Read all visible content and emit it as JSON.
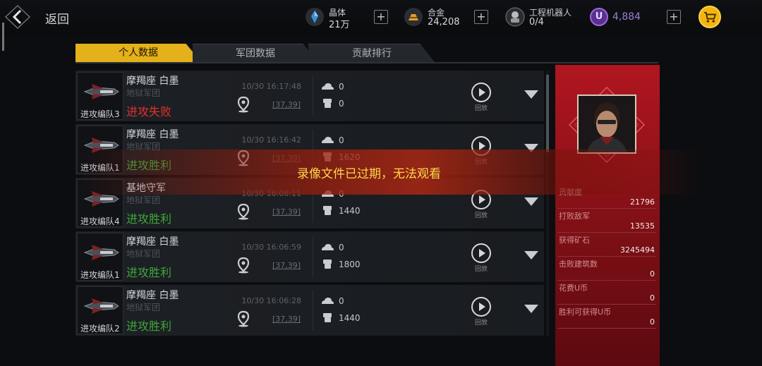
{
  "header": {
    "back_label": "返回",
    "resources": [
      {
        "name": "晶体",
        "value": "21万",
        "icon": "crystal-icon",
        "color": "#3a8fd6"
      },
      {
        "name": "合金",
        "value": "24,208",
        "icon": "alloy-icon",
        "color": "#e0a028"
      },
      {
        "name": "工程机器人",
        "value": "0/4",
        "icon": "robot-icon",
        "color": "#bbbbbb"
      }
    ],
    "u_coin": {
      "symbol": "U",
      "value": "4,884"
    },
    "plus": "+"
  },
  "tabs": [
    {
      "label": "个人数据",
      "active": true
    },
    {
      "label": "军团数据",
      "active": false
    },
    {
      "label": "贡献排行",
      "active": false
    }
  ],
  "records": [
    {
      "team": "进攻编队3",
      "opponent": "摩羯座 白墨",
      "legion": "地狱军团",
      "result": "进攻失败",
      "result_type": "fail",
      "time": "10/30 16:17:48",
      "coord": "[37,39]",
      "loot": "0",
      "power": "0",
      "replay": "回放"
    },
    {
      "team": "进攻编队1",
      "opponent": "摩羯座 白墨",
      "legion": "地狱军团",
      "result": "进攻胜利",
      "result_type": "win",
      "time": "10/30 16:16:42",
      "coord": "[37,39]",
      "loot": "0",
      "power": "1620",
      "replay": "回放"
    },
    {
      "team": "进攻编队4",
      "opponent": "基地守军",
      "legion": "地狱军团",
      "result": "进攻胜利",
      "result_type": "win",
      "time": "10/30 16:08:11",
      "coord": "[37,39]",
      "loot": "0",
      "power": "1440",
      "replay": "回放"
    },
    {
      "team": "进攻编队1",
      "opponent": "摩羯座 白墨",
      "legion": "地狱军团",
      "result": "进攻胜利",
      "result_type": "win",
      "time": "10/30 16:06:59",
      "coord": "[37,39]",
      "loot": "0",
      "power": "1800",
      "replay": "回放"
    },
    {
      "team": "进攻编队2",
      "opponent": "摩羯座 白墨",
      "legion": "地狱军团",
      "result": "进攻胜利",
      "result_type": "win",
      "time": "10/30 16:06:28",
      "coord": "[37,39]",
      "loot": "0",
      "power": "1440",
      "replay": "回放"
    }
  ],
  "stats": [
    {
      "label": "贡献度",
      "value": "21796"
    },
    {
      "label": "打败敌军",
      "value": "13535"
    },
    {
      "label": "获得矿石",
      "value": "3245494"
    },
    {
      "label": "击败建筑数",
      "value": "0"
    },
    {
      "label": "花费U币",
      "value": "0"
    },
    {
      "label": "胜利可获得U币",
      "value": "0"
    }
  ],
  "toast": "录像文件已过期，无法观看",
  "colors": {
    "accent": "#e4b11a",
    "fail": "#e0322e",
    "win": "#3fa63a",
    "panel": "#b11620"
  }
}
